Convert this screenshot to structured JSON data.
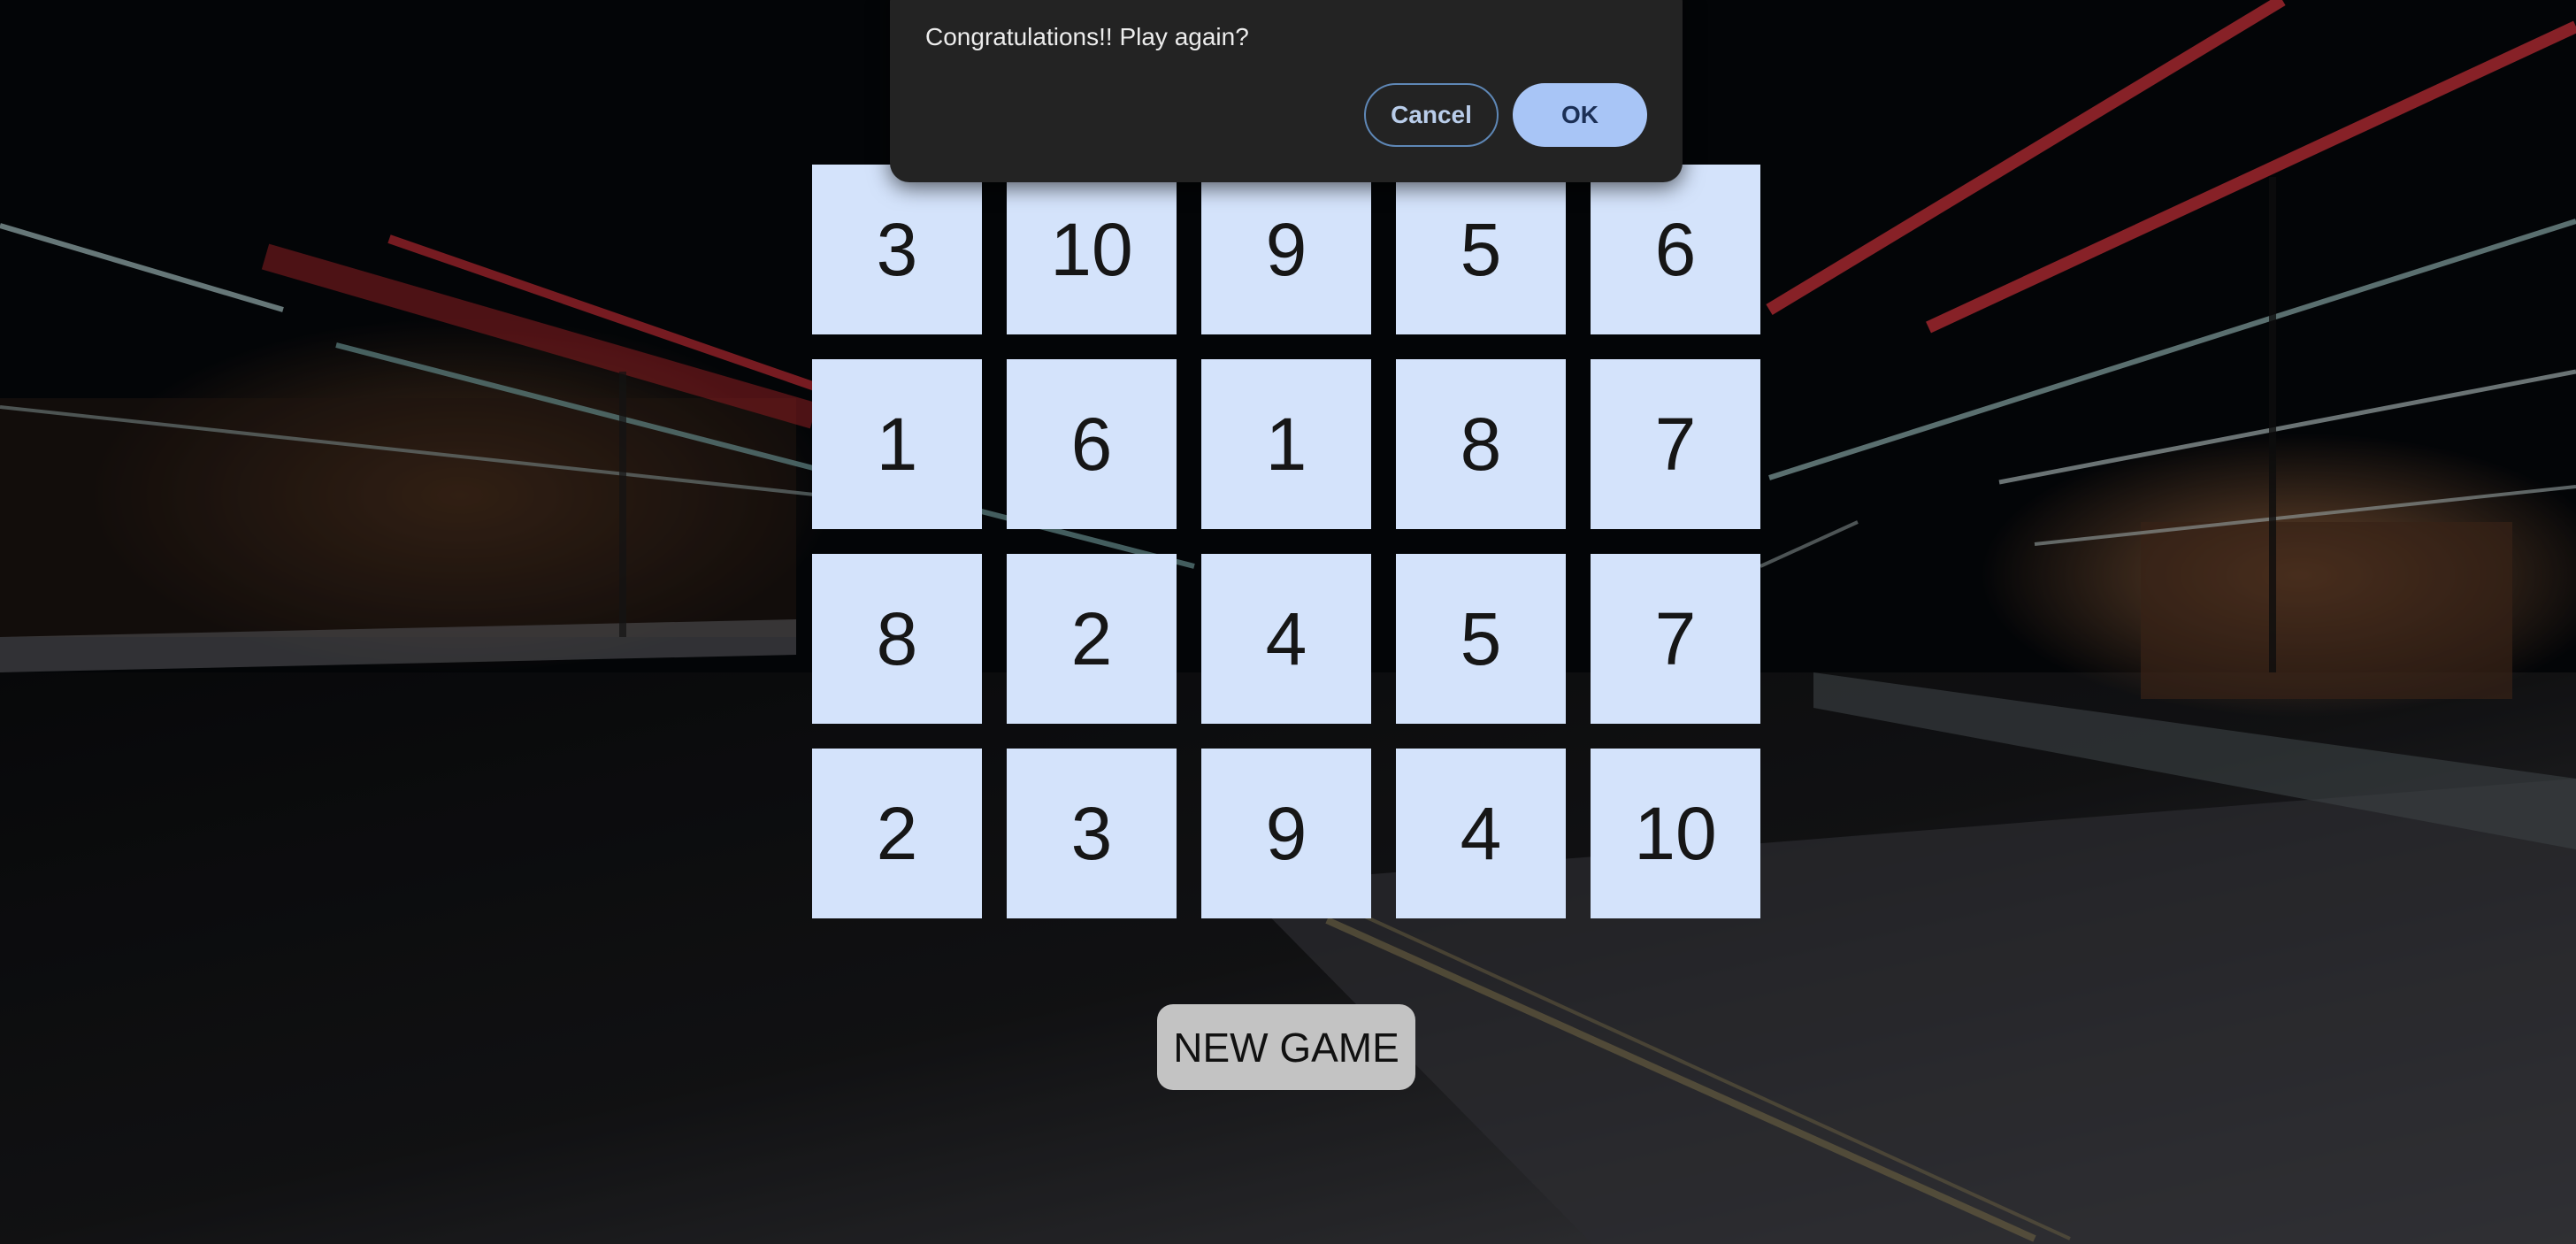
{
  "dialog": {
    "message": "Congratulations!! Play again?",
    "cancel_label": "Cancel",
    "ok_label": "OK"
  },
  "board": {
    "rows": [
      [
        "3",
        "10",
        "9",
        "5",
        "6"
      ],
      [
        "1",
        "6",
        "1",
        "8",
        "7"
      ],
      [
        "8",
        "2",
        "4",
        "5",
        "7"
      ],
      [
        "2",
        "3",
        "9",
        "4",
        "10"
      ]
    ]
  },
  "controls": {
    "new_game_label": "NEW GAME"
  },
  "colors": {
    "card": "#d4e3fb",
    "dialog": "#232323",
    "ok_button": "#a8c5f6",
    "new_game_button": "#c3c3c3"
  }
}
